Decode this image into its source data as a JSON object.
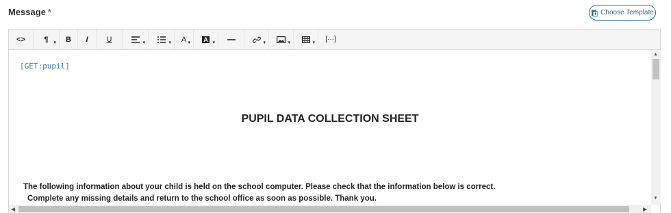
{
  "field": {
    "label": "Message",
    "required_mark": "*"
  },
  "template_button": {
    "label": "Choose Template",
    "icon": "template-icon"
  },
  "toolbar": {
    "code_view": "<>",
    "paragraph": "¶",
    "bold": "B",
    "italic": "I",
    "underline": "U",
    "align": "align-icon",
    "list": "list-icon",
    "font_color": "A",
    "background_color": "A",
    "horizontal_rule": "hr-icon",
    "link": "link-icon",
    "picture": "picture-icon",
    "table": "table-icon",
    "placeholder": "[···]"
  },
  "content": {
    "tag": "[GET:pupil]",
    "title": "PUPIL DATA COLLECTION SHEET",
    "line1": "The following information about your child is held on the school computer.  Please check that the information below is correct.",
    "line2": "Complete any missing details and return to the school office as soon as possible. Thank you."
  },
  "colors": {
    "accent": "#2e6e9e",
    "required": "#d9534f",
    "tag": "#4a78a8"
  }
}
